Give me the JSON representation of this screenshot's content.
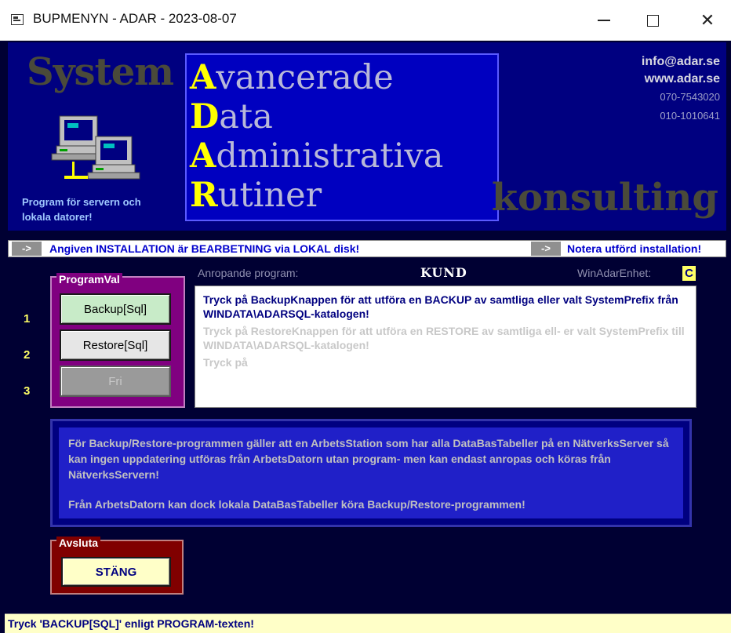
{
  "window": {
    "title": "BUPMENYN - ADAR - 2023-08-07",
    "controls": {
      "minimize": "minimize-icon",
      "maximize": "maximize-icon",
      "close": "✕"
    }
  },
  "header": {
    "system_title": "System",
    "left_subtitle_1": "Program för servern och",
    "left_subtitle_2": "lokala datorer!",
    "adar": [
      {
        "cap": "A",
        "rest": "vancerade"
      },
      {
        "cap": "D",
        "rest": "ata"
      },
      {
        "cap": "A",
        "rest": "dministrativa"
      },
      {
        "cap": "R",
        "rest": "utiner"
      }
    ],
    "email": "info@adar.se",
    "web": "www.adar.se",
    "phone1": "070-7543020",
    "phone2": "010-1010641",
    "konsult": "konsulting"
  },
  "infobar": {
    "arrow": "->",
    "left_text": "Angiven INSTALLATION är BEARBETNING via LOKAL disk!",
    "right_text": "Notera utförd installation!"
  },
  "program": {
    "group_title": "ProgramVal",
    "numbers": [
      "1",
      "2",
      "3"
    ],
    "backup_label": "Backup[Sql]",
    "restore_label": "Restore[Sql]",
    "fri_label": "Fri",
    "anrop_label": "Anropande program:",
    "anrop_value": "KUND",
    "enhet_label": "WinAdarEnhet:",
    "enhet_value": "C",
    "text_backup": "Tryck på BackupKnappen för att utföra en BACKUP av samtliga eller valt SystemPrefix från WINDATA\\ADARSQL-katalogen!",
    "text_restore": "Tryck på RestoreKnappen för att utföra en RESTORE av samtliga ell- er  valt SystemPrefix till WINDATA\\ADARSQL-katalogen!",
    "text_fri": "Tryck på"
  },
  "note": {
    "paragraph1": "För Backup/Restore-programmen gäller att en ArbetsStation som har alla DataBasTabeller på en NätverksServer så kan ingen uppdatering utföras från ArbetsDatorn utan program- men kan endast anropas och köras från NätverksServern!",
    "paragraph2": "Från ArbetsDatorn kan dock lokala DataBasTabeller köra Backup/Restore-programmen!"
  },
  "exit": {
    "group_title": "Avsluta",
    "button_label": "STÄNG"
  },
  "status": {
    "text": "Tryck 'BACKUP[SQL]' enligt PROGRAM-texten!"
  }
}
